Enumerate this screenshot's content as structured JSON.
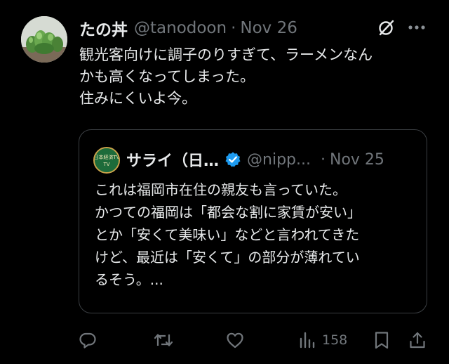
{
  "tweet": {
    "display_name": "たの丼",
    "handle": "@tanodoon",
    "separator": "·",
    "date": "Nov 26",
    "text_lines": [
      "観光客向けに調子のりすぎて、ラーメンなん",
      "かも高くなってしまった。",
      "住みにくいよ今。"
    ]
  },
  "quote": {
    "display_name": "サライ（日…",
    "handle": "@nipp...",
    "separator": "·",
    "date": "Nov 25",
    "avatar_text": "日本経済TV",
    "text_lines": [
      "これは福岡市在住の親友も言っていた。",
      "かつての福岡は「都会な割に家賃が安い」",
      "とか「安くて美味い」などと言われてきた",
      "けど、最近は「安くて」の部分が薄れてい",
      "るそう。..."
    ]
  },
  "actions": {
    "views_count": "158"
  },
  "colors": {
    "background": "#000000",
    "text_primary": "#e7e9ea",
    "text_muted": "#71767b",
    "verified": "#1d9bf0",
    "border": "#3b3f43"
  },
  "icons": {
    "top_right": [
      "grok-icon",
      "more-icon"
    ],
    "action_bar": [
      "reply-icon",
      "retweet-icon",
      "like-icon",
      "views-icon",
      "bookmark-icon",
      "share-icon"
    ],
    "badge": "verified-badge-icon"
  }
}
